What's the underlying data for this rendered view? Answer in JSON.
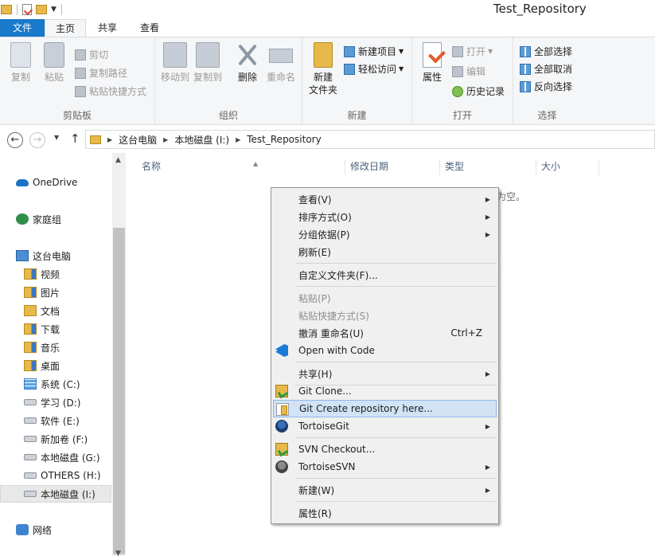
{
  "window": {
    "title": "Test_Repository"
  },
  "ribbon_tabs": {
    "file": "文件",
    "home": "主页",
    "share": "共享",
    "view": "查看"
  },
  "clipboard": {
    "copy": "复制",
    "paste": "粘贴",
    "cut": "剪切",
    "copy_path": "复制路径",
    "paste_shortcut": "粘贴快捷方式",
    "group": "剪贴板"
  },
  "organize": {
    "move_to": "移动到",
    "copy_to": "复制到",
    "delete": "删除",
    "rename": "重命名",
    "group": "组织"
  },
  "new": {
    "new_folder_line1": "新建",
    "new_folder_line2": "文件夹",
    "new_item": "新建项目",
    "easy_access": "轻松访问",
    "group": "新建"
  },
  "open": {
    "properties": "属性",
    "open": "打开",
    "edit": "编辑",
    "history": "历史记录",
    "group": "打开"
  },
  "select": {
    "select_all": "全部选择",
    "select_none": "全部取消",
    "invert": "反向选择",
    "group": "选择"
  },
  "address": {
    "crumbs": [
      "这台电脑",
      "本地磁盘 (I:)",
      "Test_Repository"
    ]
  },
  "nav": {
    "onedrive": "OneDrive",
    "homegroup": "家庭组",
    "this_pc": "这台电脑",
    "items": [
      "视频",
      "图片",
      "文档",
      "下载",
      "音乐",
      "桌面",
      "系统 (C:)",
      "学习 (D:)",
      "软件 (E:)",
      "新加卷 (F:)",
      "本地磁盘 (G:)",
      "OTHERS (H:)",
      "本地磁盘 (I:)"
    ],
    "network": "网络"
  },
  "columns": {
    "name": "名称",
    "modified": "修改日期",
    "type": "类型",
    "size": "大小"
  },
  "empty_text": "为空。",
  "context_menu": {
    "view": "查看(V)",
    "sort_by": "排序方式(O)",
    "group_by": "分组依据(P)",
    "refresh": "刷新(E)",
    "customize": "自定义文件夹(F)...",
    "paste": "粘贴(P)",
    "paste_shortcut": "粘贴快捷方式(S)",
    "undo_rename": "撤消 重命名(U)",
    "undo_shortcut": "Ctrl+Z",
    "open_with_code": "Open with Code",
    "share_with": "共享(H)",
    "git_clone": "Git Clone...",
    "git_create": "Git Create repository here...",
    "tortoisegit": "TortoiseGit",
    "svn_checkout": "SVN Checkout...",
    "tortoisesvn": "TortoiseSVN",
    "new": "新建(W)",
    "properties": "属性(R)"
  }
}
